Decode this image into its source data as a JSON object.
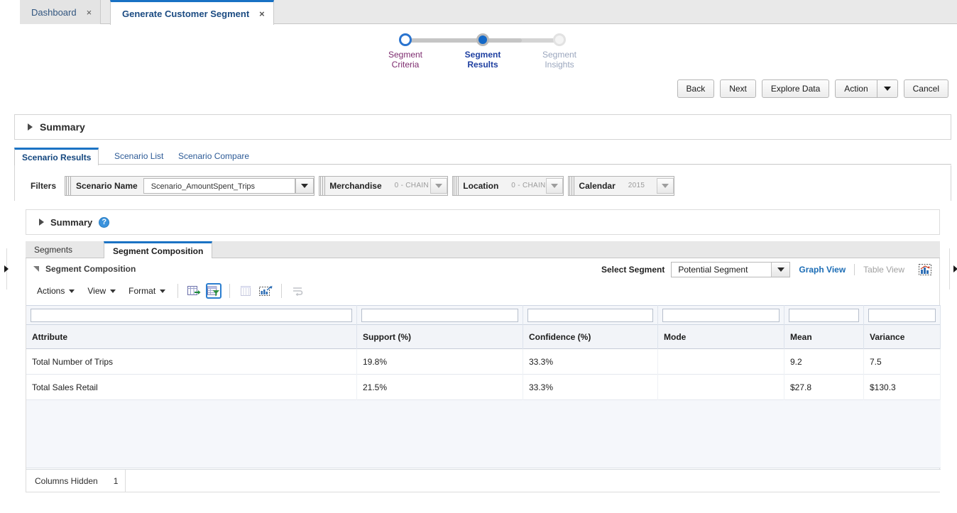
{
  "browser_tabs": [
    {
      "label": "Dashboard",
      "close": "×",
      "active": false
    },
    {
      "label": "Generate Customer Segment",
      "close": "×",
      "active": true
    }
  ],
  "train": {
    "steps": [
      {
        "line1": "Segment",
        "line2": "Criteria",
        "state": "done"
      },
      {
        "line1": "Segment",
        "line2": "Results",
        "state": "current"
      },
      {
        "line1": "Segment",
        "line2": "Insights",
        "state": "todo"
      }
    ]
  },
  "commands": {
    "back": "Back",
    "next": "Next",
    "explore_data": "Explore Data",
    "action": "Action",
    "action_caret": "caret-down-icon",
    "cancel": "Cancel"
  },
  "outer_panel": {
    "title": "Summary",
    "disclosure": "collapsed"
  },
  "tabs1": [
    {
      "label": "Scenario Results",
      "selected": true
    },
    {
      "label": "Scenario List",
      "selected": false
    },
    {
      "label": "Scenario Compare",
      "selected": false
    }
  ],
  "filters": {
    "label": "Filters",
    "items": [
      {
        "name": "Scenario Name",
        "value": "Scenario_AmountSpent_Trips",
        "style": "input",
        "enabled": true
      },
      {
        "name": "Merchandise",
        "value": "0 - CHAIN",
        "style": "plain",
        "enabled": false
      },
      {
        "name": "Location",
        "value": "0 - CHAIN",
        "style": "plain",
        "enabled": false
      },
      {
        "name": "Calendar",
        "value": "2015",
        "style": "plain",
        "enabled": false
      }
    ]
  },
  "inner_panel": {
    "title": "Summary",
    "help": "?",
    "disclosure": "collapsed"
  },
  "tabs2": [
    {
      "label": "Segments",
      "selected": false
    },
    {
      "label": "Segment Composition",
      "selected": true
    }
  ],
  "composition": {
    "title": "Segment Composition",
    "select_segment_label": "Select Segment",
    "select_segment_value": "Potential Segment",
    "graph_view": "Graph View",
    "table_view": "Table View",
    "chart_icon": "bar-chart-icon",
    "toolbar": {
      "actions": "Actions",
      "view": "View",
      "format": "Format",
      "icons": [
        {
          "name": "export-to-excel-icon",
          "state": "enabled"
        },
        {
          "name": "query-by-example-icon",
          "state": "active"
        },
        {
          "name": "freeze-columns-icon",
          "state": "disabled"
        },
        {
          "name": "detach-chart-icon",
          "state": "enabled"
        },
        {
          "name": "wrap-text-icon",
          "state": "disabled"
        }
      ]
    },
    "table": {
      "columns": [
        "Attribute",
        "Support (%)",
        "Confidence (%)",
        "Mode",
        "Mean",
        "Variance"
      ],
      "filter_values": [
        "",
        "",
        "",
        "",
        "",
        ""
      ],
      "rows": [
        {
          "attribute": "Total Number of Trips",
          "support": "19.8%",
          "confidence": "33.3%",
          "mode": "",
          "mean": "9.2",
          "variance": "7.5"
        },
        {
          "attribute": "Total Sales Retail",
          "support": "21.5%",
          "confidence": "33.3%",
          "mode": "",
          "mean": "$27.8",
          "variance": "$130.3"
        }
      ],
      "footer": {
        "columns_hidden_label": "Columns Hidden",
        "columns_hidden_count": "1"
      }
    }
  },
  "colors": {
    "accent_blue": "#1b73c4",
    "link_blue": "#1b6cb5",
    "step_done": "#7d2b6e",
    "step_current": "#1e3fa0",
    "step_todo": "#9aa6bd"
  }
}
